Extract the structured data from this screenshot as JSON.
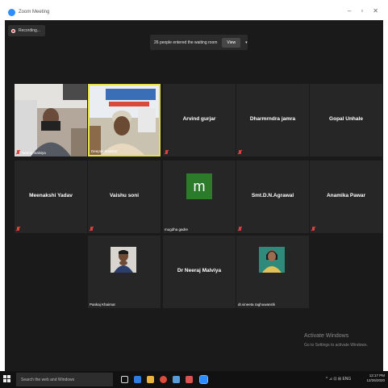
{
  "window": {
    "title": "Zoom Meeting",
    "minimize": "–",
    "restore": "▫",
    "close": "✕"
  },
  "recording": {
    "label": "Recording..."
  },
  "notice": {
    "text": "26 people entered the waiting room",
    "view_label": "View",
    "caret": "▾"
  },
  "tiles": [
    {
      "id": "neeraj-malviya",
      "label": "Neeraj malviya",
      "type": "video",
      "muted": true
    },
    {
      "id": "deepak-malakar",
      "label": "Deepak Malakar",
      "type": "video",
      "muted": false,
      "active": true
    },
    {
      "id": "arvind-gurjar",
      "name": "Arvind gurjar",
      "type": "name",
      "muted": true
    },
    {
      "id": "dharmendra-jamra",
      "name": "Dharmrndra jamra",
      "type": "name",
      "muted": true
    },
    {
      "id": "gopal-unhale",
      "name": "Gopal Unhale",
      "type": "name",
      "muted": false
    },
    {
      "id": "meenakshi-yadav",
      "name": "Meenakshi Yadav",
      "type": "name",
      "muted": true
    },
    {
      "id": "vaishu-soni",
      "name": "Vaishu soni",
      "type": "name",
      "muted": true
    },
    {
      "id": "mugdha-gadre",
      "label": "mugdha gadre",
      "type": "avatar",
      "initial": "m",
      "muted": false
    },
    {
      "id": "smt-dn-agrawal",
      "name": "Smt.D.N.Agrawal",
      "type": "name",
      "muted": true
    },
    {
      "id": "anamika-pawar",
      "name": "Anamika Pawar",
      "type": "name",
      "muted": true
    },
    {
      "id": "pankaj-khairnar",
      "label": "Pankaj Khairnar",
      "type": "photo",
      "muted": false
    },
    {
      "id": "dr-neeraj-malviya",
      "name": "Dr Neeraj Malviya",
      "type": "name",
      "muted": false
    },
    {
      "id": "dr-vineeta-raghuwanshi",
      "label": "dr.vineeta raghuwanshi",
      "type": "photo",
      "muted": false
    }
  ],
  "watermark": {
    "title": "Activate Windows",
    "subtitle": "Go to Settings to activate Windows."
  },
  "taskbar": {
    "search_placeholder": "Search the web and Windows",
    "tray_text": "^ ⊿ ⊡ ⊞ ENG",
    "time": "12:17 PM",
    "date": "12/26/2020"
  },
  "colors": {
    "active_border": "#e5e24a",
    "mute": "#e0413b",
    "avatar_bg": "#2b7b2b",
    "tile_bg": "#262626"
  }
}
